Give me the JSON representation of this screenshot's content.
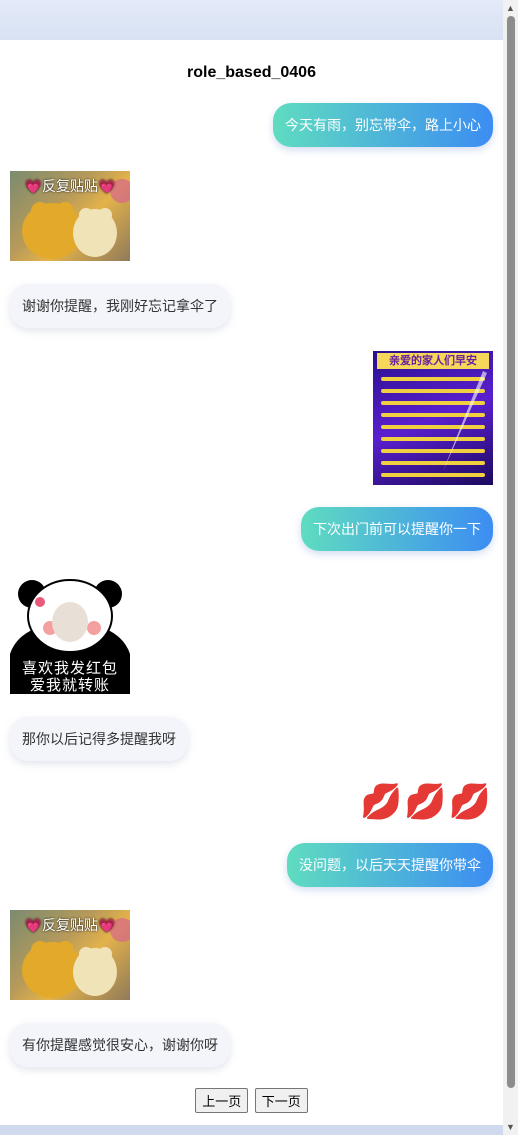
{
  "title": "role_based_0406",
  "messages": [
    {
      "text": "今天有雨，别忘带伞，路上小心"
    },
    {
      "sticker_text": "💗反复贴贴💗"
    },
    {
      "text": "谢谢你提醒，我刚好忘记拿伞了"
    },
    {
      "poster_title": "亲爱的家人们早安"
    },
    {
      "text": "下次出门前可以提醒你一下"
    },
    {
      "sticker_line1": "喜欢我发红包",
      "sticker_line2": "爱我就转账"
    },
    {
      "text": "那你以后记得多提醒我呀"
    },
    {
      "emojis": "💋💋💋"
    },
    {
      "text": "没问题，以后天天提醒你带伞"
    },
    {
      "sticker_text": "💗反复贴贴💗"
    },
    {
      "text": "有你提醒感觉很安心，谢谢你呀"
    }
  ],
  "pager": {
    "prev": "上一页",
    "next": "下一页"
  },
  "colors": {
    "bubble_gradient_start": "#5fdcc0",
    "bubble_gradient_end": "#3c8df2",
    "left_bubble": "#f3f5fa"
  }
}
